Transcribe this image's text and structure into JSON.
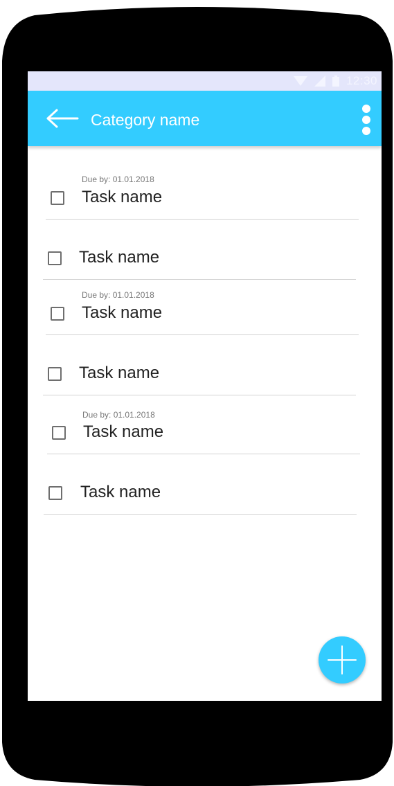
{
  "status_bar": {
    "time": "12:30",
    "icons": [
      "wifi-icon",
      "signal-icon",
      "battery-icon"
    ]
  },
  "app_bar": {
    "back_icon": "arrow-left-icon",
    "title": "Category name",
    "menu_icon": "more-vertical-icon"
  },
  "tasks": [
    {
      "name": "Task name",
      "due": "Due by: 01.01.2018",
      "checked": false
    },
    {
      "name": "Task name",
      "due": "",
      "checked": false
    },
    {
      "name": "Task name",
      "due": "Due by: 01.01.2018",
      "checked": false
    },
    {
      "name": "Task name",
      "due": "",
      "checked": false
    },
    {
      "name": "Task name",
      "due": "Due by: 01.01.2018",
      "checked": false
    },
    {
      "name": "Task name",
      "due": "",
      "checked": false
    }
  ],
  "fab": {
    "icon": "plus-icon"
  },
  "colors": {
    "primary": "#33ccff",
    "status_bar": "#e4e6fb",
    "device": "#000000",
    "text": "#222222",
    "secondary_text": "#777777",
    "divider": "#d2d2d2"
  }
}
